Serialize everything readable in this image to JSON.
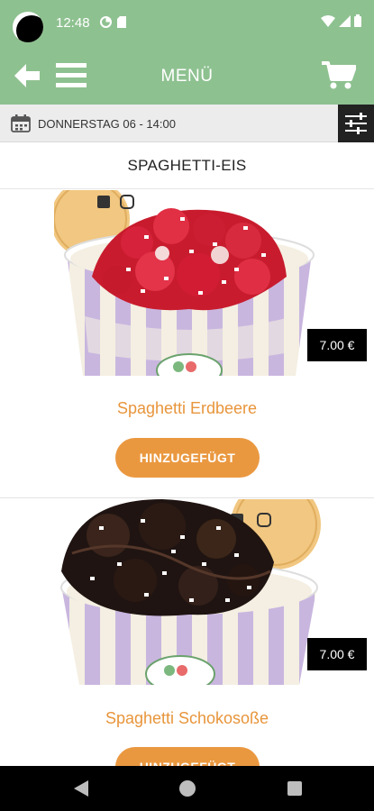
{
  "status_bar": {
    "time": "12:48"
  },
  "app_bar": {
    "title": "MENÜ"
  },
  "date_bar": {
    "text": "DONNERSTAG 06 - 14:00"
  },
  "section": {
    "title": "SPAGHETTI-EIS"
  },
  "products": [
    {
      "name": "Spaghetti Erdbeere",
      "price": "7.00 €",
      "button_label": "HINZUGEFÜGT",
      "topping": "strawberry"
    },
    {
      "name": "Spaghetti Schokosoße",
      "price": "7.00 €",
      "button_label": "HINZUGEFÜGT",
      "topping": "chocolate"
    }
  ],
  "colors": {
    "header_green": "#8ec190",
    "accent_orange": "#ea9840",
    "product_name_orange": "#e8953b",
    "price_badge": "#000000",
    "cup_stripe_purple": "#c9b6df",
    "cup_stripe_cream": "#f4efe2"
  },
  "icons": {
    "back": "arrow-left-icon",
    "menu": "hamburger-icon",
    "cart": "shopping-cart-icon",
    "calendar": "calendar-icon",
    "filter": "sliders-icon"
  }
}
